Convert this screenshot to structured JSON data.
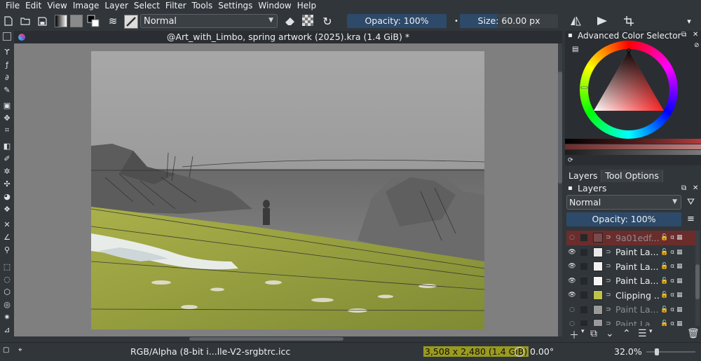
{
  "menubar": {
    "items": [
      "File",
      "Edit",
      "View",
      "Image",
      "Layer",
      "Select",
      "Filter",
      "Tools",
      "Settings",
      "Window",
      "Help"
    ]
  },
  "toolbar": {
    "blend_mode": "Normal",
    "opacity_label": "Opacity: 100%",
    "opacity": 1.0,
    "size_label": "Size: 60.00 px",
    "size_fill": 0.38,
    "icons": [
      "new-document-icon",
      "open-document-icon",
      "save-icon",
      "gradient-icon",
      "pattern-icon",
      "swap-colors-icon",
      "brush-settings-icon",
      "brush-preset-icon",
      "eraser-icon",
      "alpha-lock-icon",
      "reload-icon",
      "mirror-horizontal-icon",
      "mirror-vertical-icon",
      "wrap-around-icon"
    ]
  },
  "document": {
    "title": "@Art_with_Limbo, spring artwork (2025).kra (1.4 GiB) *"
  },
  "color_selector": {
    "title": "Advanced Color Selector",
    "accent": "#d02c2c"
  },
  "panel_tabs": [
    "Layers",
    "Tool Options"
  ],
  "layers_panel": {
    "title": "Layers",
    "blend_mode": "Normal",
    "opacity_label": "Opacity:  100%",
    "layers": [
      {
        "name": "9a01edf...",
        "visible": false,
        "selected": true
      },
      {
        "name": "Paint La...",
        "visible": true,
        "selected": false
      },
      {
        "name": "Paint La...",
        "visible": true,
        "selected": false
      },
      {
        "name": "Paint La...",
        "visible": true,
        "selected": false
      },
      {
        "name": "Clipping ...",
        "visible": true,
        "selected": false
      },
      {
        "name": "Paint La...",
        "visible": false,
        "selected": false
      },
      {
        "name": "Paint La...",
        "visible": false,
        "selected": false
      }
    ]
  },
  "statusbar": {
    "color_profile": "RGB/Alpha (8-bit i...lle-V2-srgbtrc.icc",
    "dimensions": "3,508 x 2,480 (1.4 GiB)",
    "rotation": "0.00°",
    "zoom": "32.0%"
  }
}
